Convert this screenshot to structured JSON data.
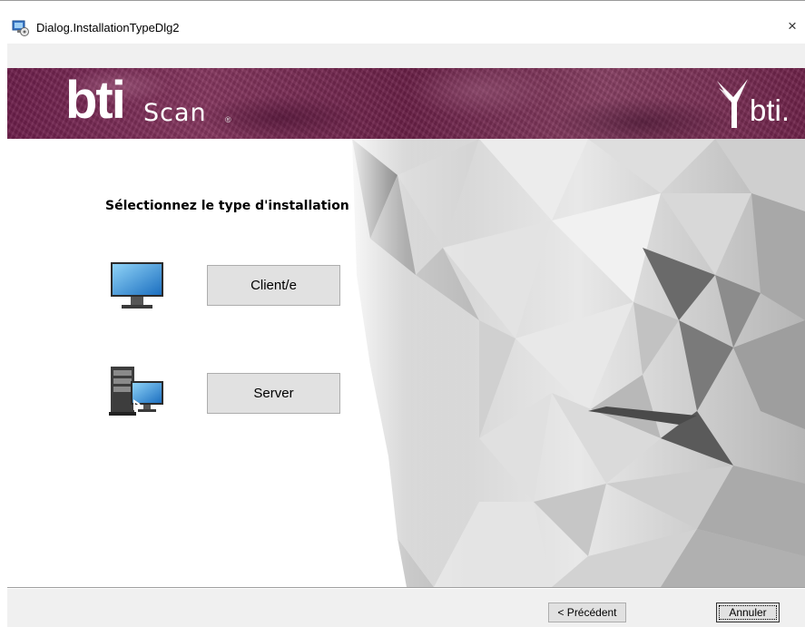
{
  "window": {
    "title": "Dialog.InstallationTypeDlg2",
    "close_glyph": "×"
  },
  "banner": {
    "brand": "bti",
    "product": "Scan",
    "registered": "®",
    "logo_text": "bti."
  },
  "main": {
    "heading": "Sélectionnez le type d'installation",
    "options": [
      {
        "label": "Client/e",
        "icon": "monitor-icon"
      },
      {
        "label": "Server",
        "icon": "server-icon"
      }
    ]
  },
  "footer": {
    "prev_label": "< Précédent",
    "cancel_label": "Annuler"
  },
  "colors": {
    "banner": "#6d1f4b",
    "button_face": "#e1e1e1",
    "footer_bg": "#f0f0f0"
  }
}
